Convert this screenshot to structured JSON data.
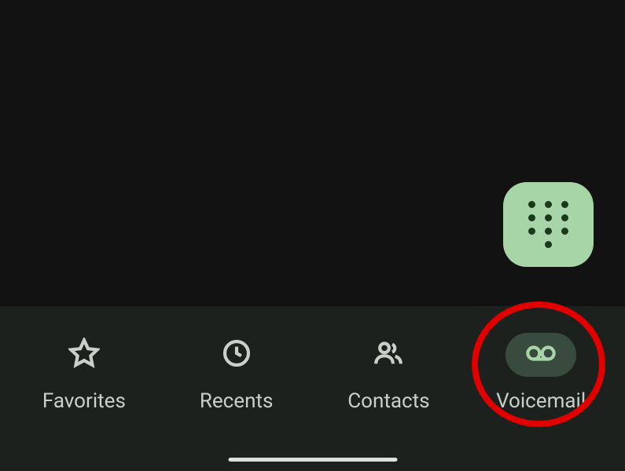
{
  "fab": {
    "icon_name": "dialpad-icon"
  },
  "nav": {
    "items": [
      {
        "label": "Favorites",
        "icon": "star",
        "selected": false
      },
      {
        "label": "Recents",
        "icon": "clock",
        "selected": false
      },
      {
        "label": "Contacts",
        "icon": "people",
        "selected": false
      },
      {
        "label": "Voicemail",
        "icon": "voicemail",
        "selected": true
      }
    ]
  },
  "annotation": {
    "highlighted_item": "Voicemail",
    "color": "#e00000"
  }
}
